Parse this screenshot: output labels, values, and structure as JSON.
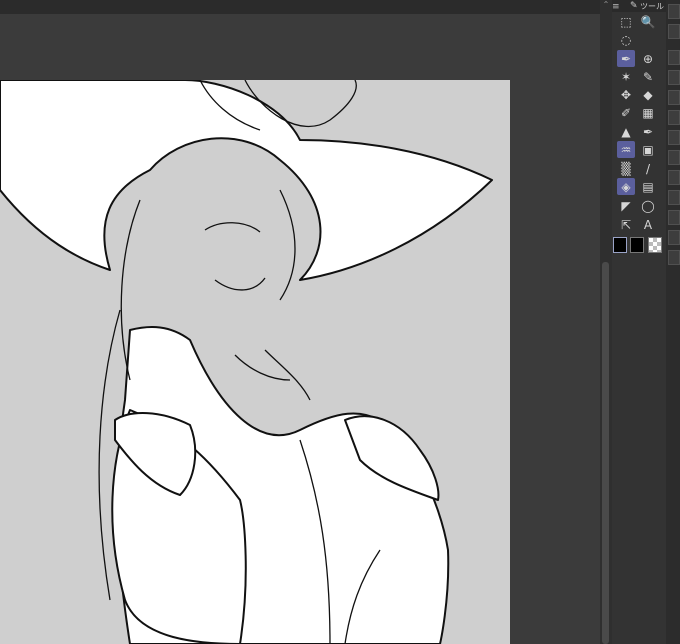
{
  "toolbox": {
    "header_label": "ツール",
    "tools": [
      {
        "name": "rectangle-select-tool",
        "glyph": "⬚"
      },
      {
        "name": "zoom-tool",
        "glyph": "🔍"
      },
      {
        "name": "lasso-select-tool",
        "glyph": "◌"
      },
      {
        "name": "pen-tool",
        "glyph": "✒"
      },
      {
        "name": "object-tool",
        "glyph": "⊕"
      },
      {
        "name": "sparkle-tool",
        "glyph": "✶"
      },
      {
        "name": "eyedropper-tool",
        "glyph": "✎"
      },
      {
        "name": "move-tool",
        "glyph": "✥"
      },
      {
        "name": "fill-bucket-tool",
        "glyph": "◆"
      },
      {
        "name": "brush-tool",
        "glyph": "✐"
      },
      {
        "name": "pattern-tool",
        "glyph": "▦"
      },
      {
        "name": "airbrush-tool",
        "glyph": "▲"
      },
      {
        "name": "ink-pen-tool",
        "glyph": "✒"
      },
      {
        "name": "decoration-tool",
        "glyph": "♒"
      },
      {
        "name": "grid-tool",
        "glyph": "▣"
      },
      {
        "name": "gradient-tool",
        "glyph": "▒"
      },
      {
        "name": "line-tool",
        "glyph": "/"
      },
      {
        "name": "eraser-tool",
        "glyph": "◈"
      },
      {
        "name": "frame-tool",
        "glyph": "▤"
      },
      {
        "name": "ruler-tool",
        "glyph": "◤"
      },
      {
        "name": "balloon-tool",
        "glyph": "◯"
      },
      {
        "name": "correct-line-tool",
        "glyph": "⇱"
      },
      {
        "name": "text-tool",
        "glyph": "A"
      }
    ],
    "colors": {
      "main": "#000000",
      "sub": "#000000",
      "transparent": "checker"
    }
  }
}
